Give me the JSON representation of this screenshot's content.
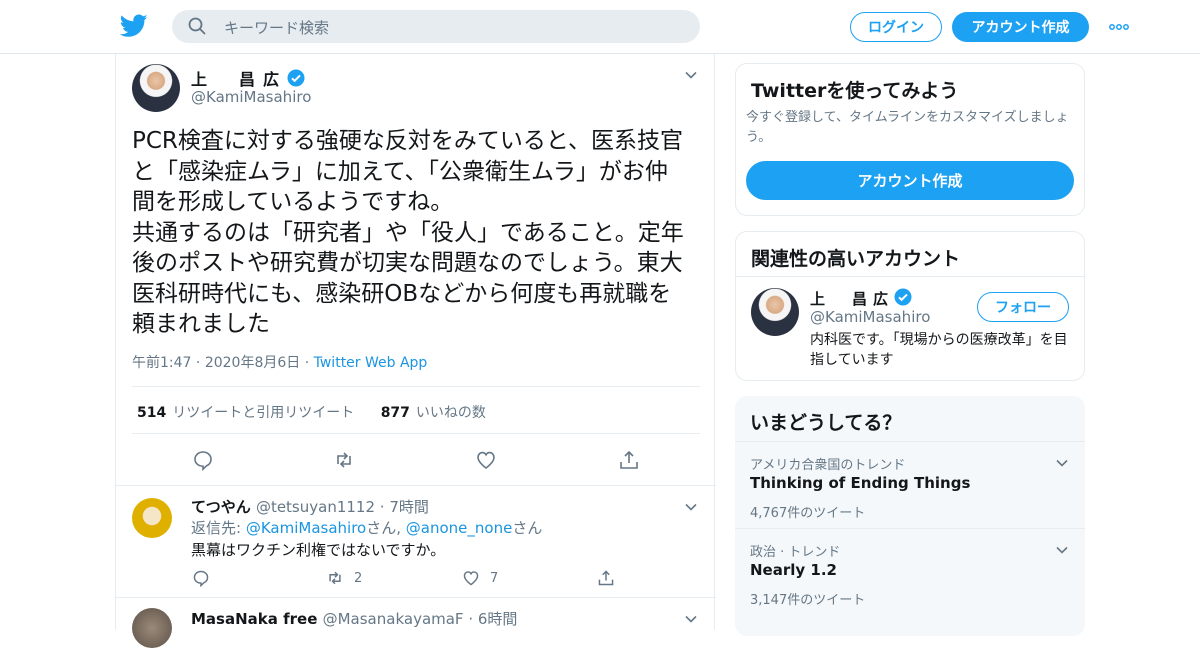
{
  "header": {
    "search_placeholder": "キーワード検索",
    "login_label": "ログイン",
    "signup_label": "アカウント作成"
  },
  "tweet": {
    "display_name": "上　昌広",
    "handle": "@KamiMasahiro",
    "text": "PCR検査に対する強硬な反対をみていると、医系技官\nと「感染症ムラ」に加えて、「公衆衛生ムラ」がお仲\n間を形成しているようですね。\n共通するのは「研究者」や「役人」であること。定年\n後のポストや研究費が切実な問題なのでしょう。東大\n医科研時代にも、感染研OBなどから何度も再就職を\n頼まれました",
    "time": "午前1:47",
    "date": "2020年8月6日",
    "source": "Twitter Web App",
    "retweet_count": "514",
    "retweet_label": "リツイートと引用リツイート",
    "like_count": "877",
    "like_label": "いいねの数"
  },
  "replies": [
    {
      "display_name": "てつやん",
      "handle": "@tetsuyan1112",
      "time": "7時間",
      "reply_to_prefix": "返信先:",
      "reply_to_1": "@KamiMasahiro",
      "reply_to_sep": "さん,",
      "reply_to_2": "@anone_none",
      "reply_to_suffix": "さん",
      "text": "黒幕はワクチン利権ではないですか。",
      "retweets": "2",
      "likes": "7"
    },
    {
      "display_name": "MasaNaka free",
      "handle": "@MasanakayamaF",
      "time": "6時間"
    }
  ],
  "sidebar": {
    "try_title": "Twitterを使ってみよう",
    "try_sub": "今すぐ登録して、タイムラインをカスタマイズしましょう。",
    "try_button": "アカウント作成",
    "related_title": "関連性の高いアカウント",
    "related_name": "上　昌広",
    "related_handle": "@KamiMasahiro",
    "follow_label": "フォロー",
    "related_bio": "内科医です。「現場からの医療改革」を目指しています",
    "trends_title": "いまどうしてる？",
    "trends": [
      {
        "category": "アメリカ合衆国のトレンド",
        "name": "Thinking of Ending Things",
        "count": "4,767件のツイート"
      },
      {
        "category": "政治 · トレンド",
        "name": "Nearly 1.2",
        "count": "3,147件のツイート"
      }
    ]
  },
  "colors": {
    "accent": "#1da1f2",
    "link": "#1b95e0",
    "muted": "#657786"
  }
}
